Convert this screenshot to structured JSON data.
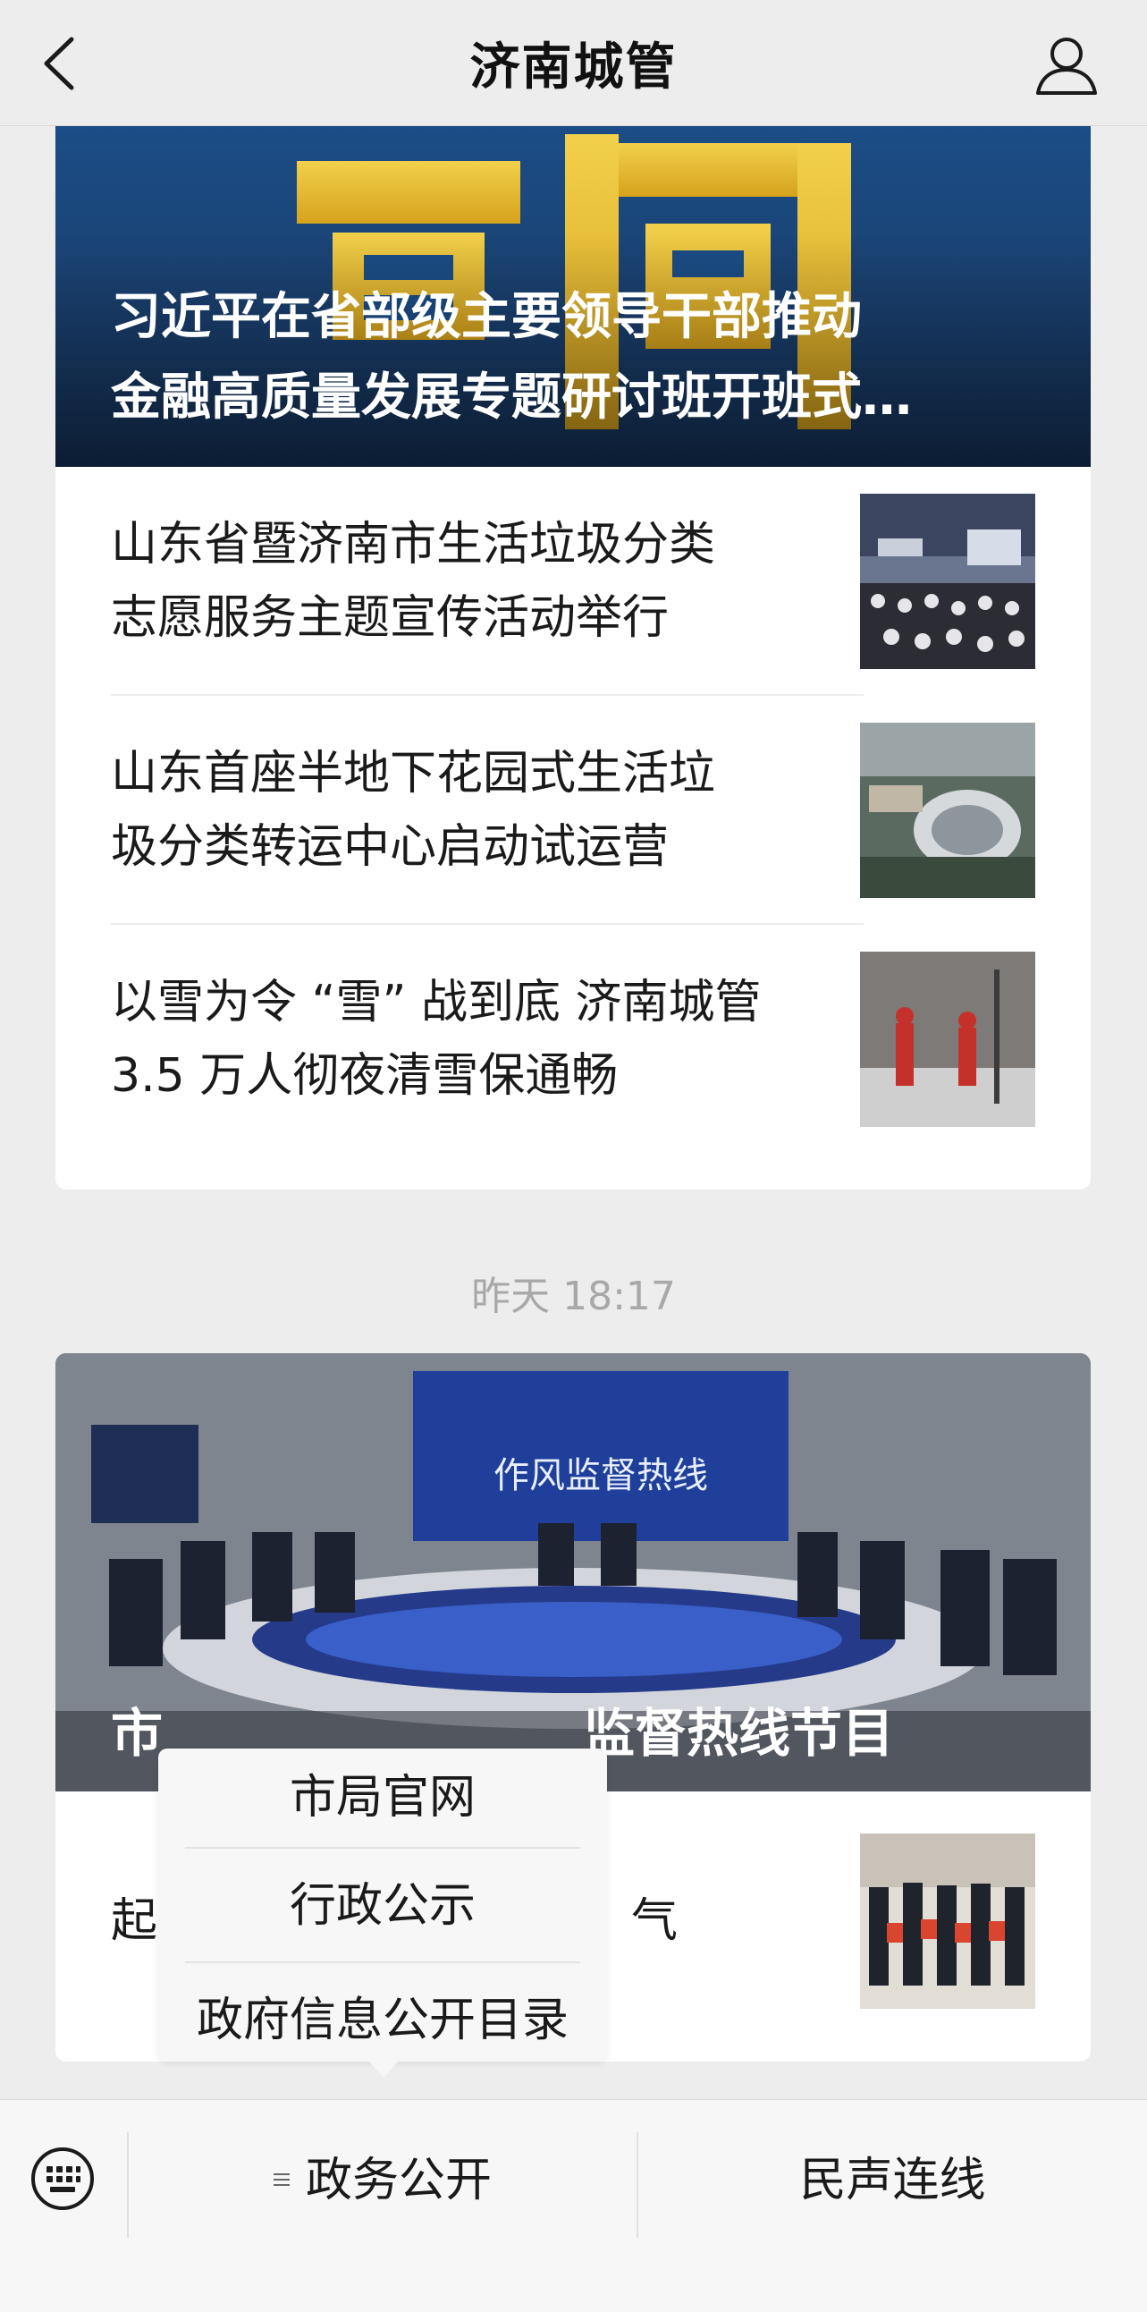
{
  "header": {
    "title": "济南城管",
    "back_icon": "chevron-left-icon",
    "user_icon": "user-icon"
  },
  "article_group_1": {
    "hero_image_text": "要闻",
    "headline_line1": "习近平在省部级主要领导干部推动",
    "headline_line2": "金融高质量发展专题研讨班开班式…",
    "items": [
      {
        "title_line1": "山东省暨济南市生活垃圾分类",
        "title_line2": "志愿服务主题宣传活动举行"
      },
      {
        "title_line1": "山东首座半地下花园式生活垃",
        "title_line2": "圾分类转运中心启动试运营"
      },
      {
        "title_line1": "以雪为令 “雪” 战到底 济南城管",
        "title_line2": "3.5 万人彻夜清雪保通畅"
      }
    ]
  },
  "timestamp": "昨天 18:17",
  "article_group_2": {
    "studio_screen_text": "作风监督热线",
    "headline_left": "市",
    "headline_right": "监督热线节目",
    "item_fragment_left": "起",
    "item_fragment_right": "气"
  },
  "popup_menu": {
    "items": [
      "市局官网",
      "行政公示",
      "政府信息公开目录"
    ]
  },
  "bottom_bar": {
    "keyboard_icon": "keyboard-icon",
    "tab1_label": "政务公开",
    "tab2_label": "民声连线"
  }
}
